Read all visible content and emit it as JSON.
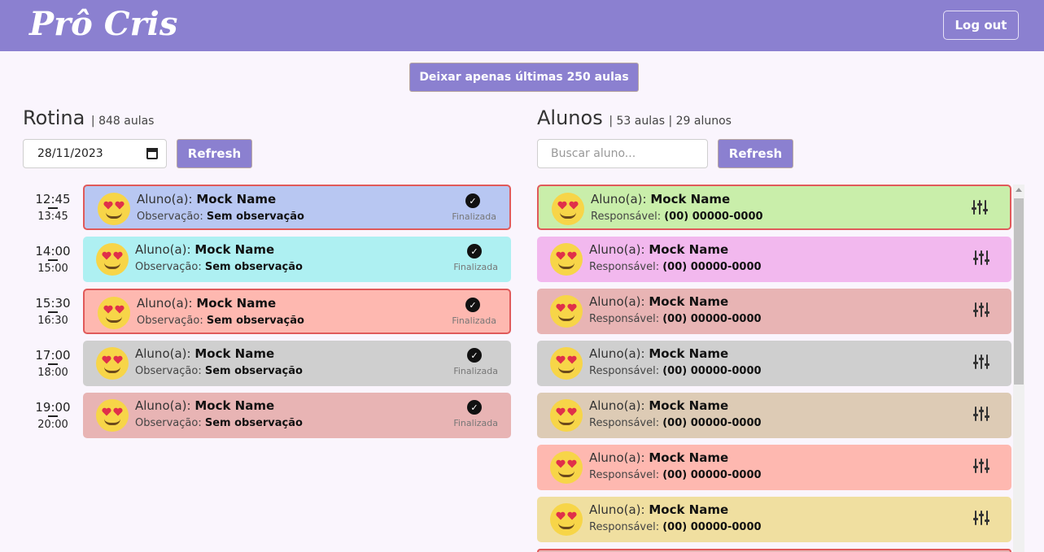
{
  "header": {
    "logo": "Prô Cris",
    "logout_label": "Log out"
  },
  "actions": {
    "keep_label": "Deixar apenas últimas 250 aulas"
  },
  "rotina": {
    "title": "Rotina",
    "meta": "| 848 aulas",
    "date_value": "28/11/2023",
    "refresh_label": "Refresh",
    "labels": {
      "aluno": "Aluno(a): ",
      "obs": "Observação: "
    },
    "items": [
      {
        "start": "12:45",
        "end": "13:45",
        "name": "Mock Name",
        "obs": "Sem observação",
        "status": "Finalizada",
        "color": "#b8c7f2",
        "selected": true
      },
      {
        "start": "14:00",
        "end": "15:00",
        "name": "Mock Name",
        "obs": "Sem observação",
        "status": "Finalizada",
        "color": "#aef0f2",
        "selected": false
      },
      {
        "start": "15:30",
        "end": "16:30",
        "name": "Mock Name",
        "obs": "Sem observação",
        "status": "Finalizada",
        "color": "#feb8b0",
        "selected": true
      },
      {
        "start": "17:00",
        "end": "18:00",
        "name": "Mock Name",
        "obs": "Sem observação",
        "status": "Finalizada",
        "color": "#cfcfcf",
        "selected": false
      },
      {
        "start": "19:00",
        "end": "20:00",
        "name": "Mock Name",
        "obs": "Sem observação",
        "status": "Finalizada",
        "color": "#e8b4b4",
        "selected": false
      }
    ]
  },
  "alunos": {
    "title": "Alunos",
    "meta": "| 53 aulas | 29 alunos",
    "search_placeholder": "Buscar aluno...",
    "refresh_label": "Refresh",
    "labels": {
      "aluno": "Aluno(a): ",
      "resp": "Responsável: "
    },
    "items": [
      {
        "name": "Mock Name",
        "phone": "(00) 00000-0000",
        "color": "#c9eeaa",
        "selected": true
      },
      {
        "name": "Mock Name",
        "phone": "(00) 00000-0000",
        "color": "#f2b8ee",
        "selected": false
      },
      {
        "name": "Mock Name",
        "phone": "(00) 00000-0000",
        "color": "#e8b4b4",
        "selected": false
      },
      {
        "name": "Mock Name",
        "phone": "(00) 00000-0000",
        "color": "#cfcfcf",
        "selected": false
      },
      {
        "name": "Mock Name",
        "phone": "(00) 00000-0000",
        "color": "#ddcbb5",
        "selected": false
      },
      {
        "name": "Mock Name",
        "phone": "(00) 00000-0000",
        "color": "#feb8b0",
        "selected": false
      },
      {
        "name": "Mock Name",
        "phone": "(00) 00000-0000",
        "color": "#f0dfa0",
        "selected": false
      }
    ]
  }
}
